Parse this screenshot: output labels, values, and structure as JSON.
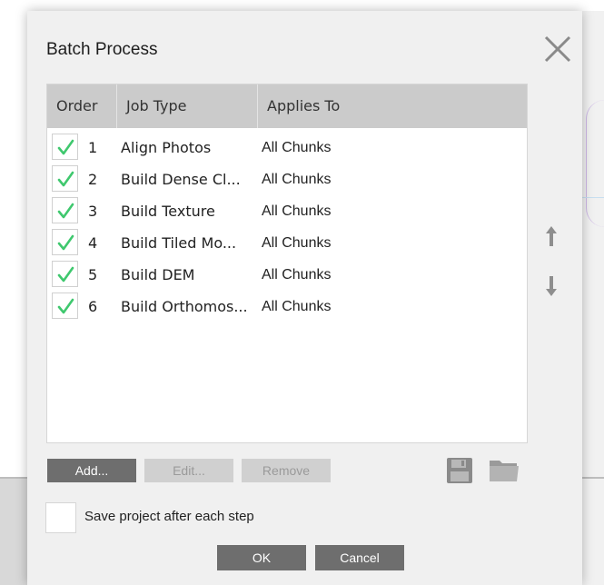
{
  "dialog": {
    "title": "Batch Process"
  },
  "table": {
    "headers": [
      "Order",
      "Job Type",
      "Applies To"
    ],
    "rows": [
      {
        "checked": true,
        "order": "1",
        "job_type": "Align Photos",
        "applies_to": "All Chunks"
      },
      {
        "checked": true,
        "order": "2",
        "job_type": "Build Dense Cl...",
        "applies_to": "All Chunks"
      },
      {
        "checked": true,
        "order": "3",
        "job_type": "Build Texture",
        "applies_to": "All Chunks"
      },
      {
        "checked": true,
        "order": "4",
        "job_type": "Build Tiled Mo...",
        "applies_to": "All Chunks"
      },
      {
        "checked": true,
        "order": "5",
        "job_type": "Build DEM",
        "applies_to": "All Chunks"
      },
      {
        "checked": true,
        "order": "6",
        "job_type": "Build Orthomos...",
        "applies_to": "All Chunks"
      }
    ]
  },
  "buttons": {
    "add": "Add...",
    "edit": "Edit...",
    "remove": "Remove",
    "ok": "OK",
    "cancel": "Cancel"
  },
  "options": {
    "save_after_each_step_label": "Save project after each step",
    "save_after_each_step_checked": false
  },
  "icons": {
    "close": "close-icon",
    "move_up": "arrow-up-icon",
    "move_down": "arrow-down-icon",
    "save": "floppy-disk-icon",
    "open": "folder-icon",
    "check": "checkmark-icon"
  },
  "colors": {
    "checkmark": "#3fc86e",
    "header_bg": "#cbcbcb",
    "button_active": "#6e6e6e",
    "button_disabled": "#d0d0d0"
  }
}
